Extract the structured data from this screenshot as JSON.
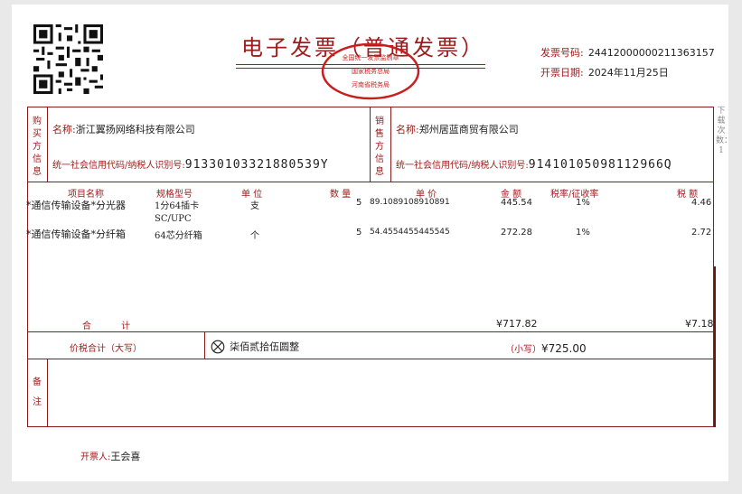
{
  "invoice": {
    "title": "电子发票（普通发票）",
    "number_label": "发票号码:",
    "number": "24412000000211363157",
    "date_label": "开票日期:",
    "date": "2024年11月25日",
    "seal_top": "全国统一发票监制章",
    "seal_mid": "国家税务总局",
    "seal_bottom": "河南省税务局"
  },
  "buyer": {
    "section_label": "购买方信息",
    "name_label": "名称:",
    "name": "浙江翼扬网络科技有限公司",
    "tax_label": "统一社会信用代码/纳税人识别号:",
    "tax_id": "91330103321880539Y"
  },
  "seller": {
    "section_label": "销售方信息",
    "name_label": "名称:",
    "name": "郑州居蓝商贸有限公司",
    "tax_label": "统一社会信用代码/纳税人识别号:",
    "tax_id": "91410105098112966Q"
  },
  "table": {
    "headers": {
      "item": "项目名称",
      "spec": "规格型号",
      "unit": "单 位",
      "qty": "数 量",
      "price": "单 价",
      "amount": "金 额",
      "rate": "税率/征收率",
      "tax": "税 额"
    },
    "rows": [
      {
        "item": "*通信传输设备*分光器",
        "spec": "1分64插卡",
        "spec2": "SC/UPC",
        "unit": "支",
        "qty": "5",
        "price": "89.1089108910891",
        "amount": "445.54",
        "rate": "1%",
        "tax": "4.46"
      },
      {
        "item": "*通信传输设备*分纤箱",
        "spec": "64芯分纤箱",
        "spec2": "",
        "unit": "个",
        "qty": "5",
        "price": "54.4554455445545",
        "amount": "272.28",
        "rate": "1%",
        "tax": "2.72"
      }
    ],
    "subtotal_label": "合 计",
    "subtotal_amount": "¥717.82",
    "subtotal_tax": "¥7.18"
  },
  "total": {
    "label": "价税合计（大写）",
    "upper_case": "柒佰贰拾伍圆整",
    "lower_label": "（小写）",
    "lower_value": "¥725.00"
  },
  "remarks": {
    "label": "备注"
  },
  "issuer": {
    "label": "开票人:",
    "name": "王会喜"
  },
  "side_note": "下载次数：1",
  "colors": {
    "accent": "#a01c1c",
    "border": "#8b1a1a",
    "background": "#e9e9e9"
  }
}
